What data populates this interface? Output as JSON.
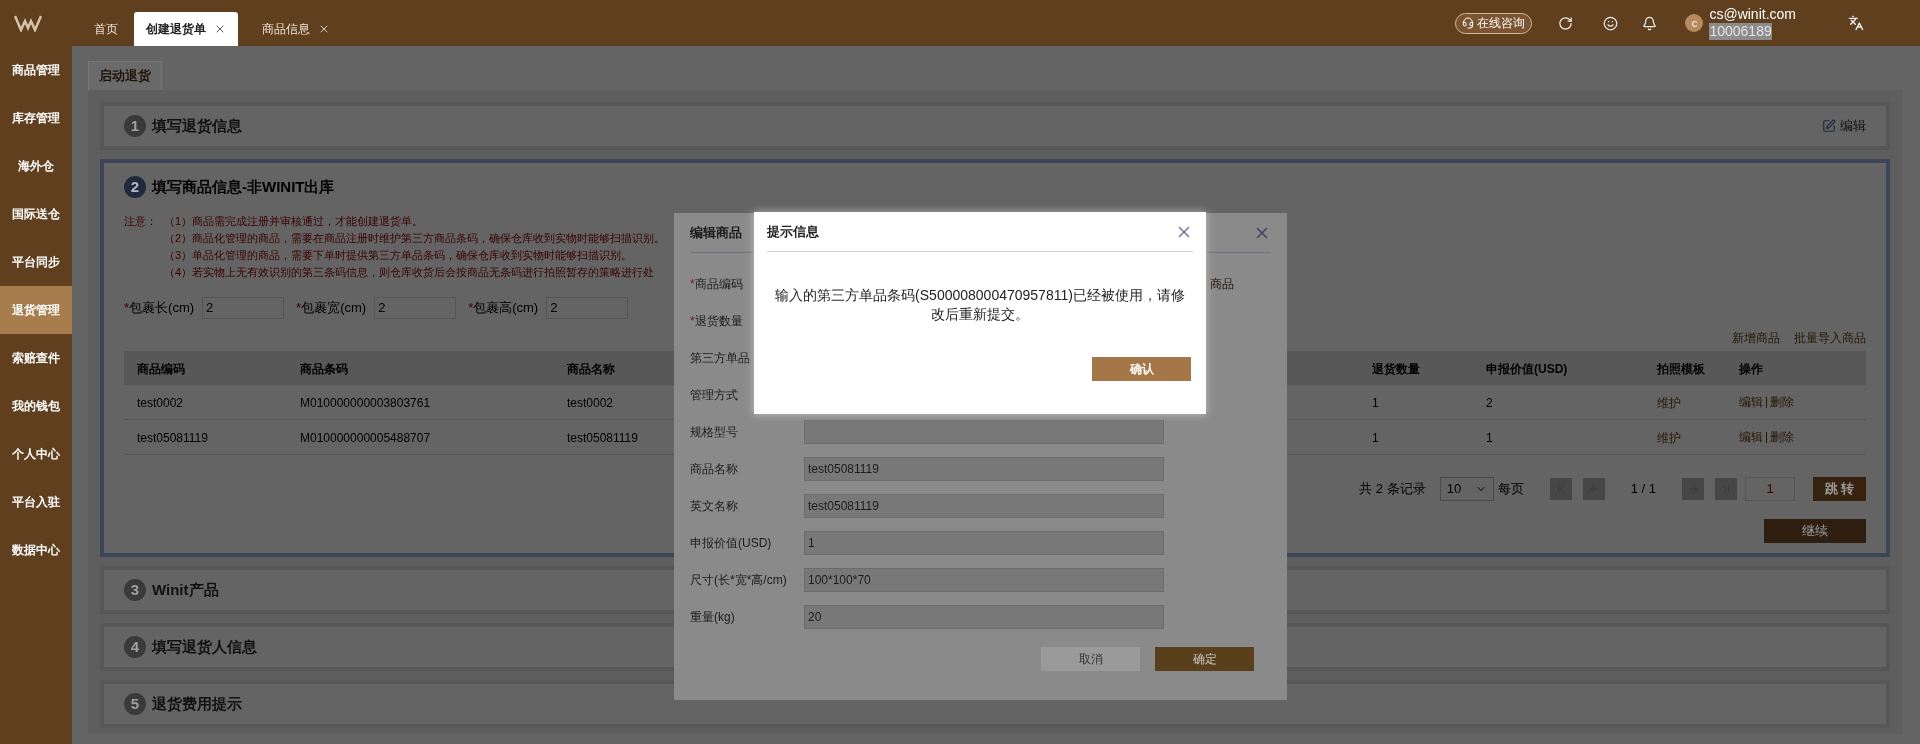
{
  "top_bar": {
    "tabs": [
      {
        "label": "首页",
        "selected": false,
        "closable": false
      },
      {
        "label": "创建退货单",
        "selected": true,
        "closable": true
      },
      {
        "label": "商品信息",
        "selected": false,
        "closable": true
      }
    ],
    "consult_button": "在线咨询",
    "user": {
      "avatar": "c",
      "email": "cs@winit.com",
      "account": "10006189"
    }
  },
  "sidebar": {
    "items": [
      {
        "label": "商品管理",
        "selected": false
      },
      {
        "label": "库存管理",
        "selected": false
      },
      {
        "label": "海外仓",
        "selected": false
      },
      {
        "label": "国际送仓",
        "selected": false
      },
      {
        "label": "平台同步",
        "selected": false
      },
      {
        "label": "退货管理",
        "selected": true
      },
      {
        "label": "索赔查件",
        "selected": false
      },
      {
        "label": "我的钱包",
        "selected": false
      },
      {
        "label": "个人中心",
        "selected": false
      },
      {
        "label": "平台入驻",
        "selected": false
      },
      {
        "label": "数据中心",
        "selected": false
      }
    ]
  },
  "page_tab": "启动退货",
  "sections": [
    {
      "number": "1",
      "title": "填写退货信息",
      "active": false,
      "action": "编辑"
    },
    {
      "number": "2",
      "title": "填写商品信息-非WINIT出库",
      "active": true
    },
    {
      "number": "3",
      "title": "Winit产品",
      "active": false
    },
    {
      "number": "4",
      "title": "填写退货人信息",
      "active": false
    },
    {
      "number": "5",
      "title": "退货费用提示",
      "active": false
    }
  ],
  "product_form": {
    "notes_label": "注意：",
    "notes": [
      "（1）商品需完成注册并审核通过，才能创建退货单。",
      "（2）商品化管理的商品，需要在商品注册时维护第三方商品条码，确保仓库收到实物时能够扫描识别。",
      "（3）单品化管理的商品，需要下单时提供第三方单品条码，确保仓库收到实物时能够扫描识别。",
      "（4）若实物上无有效识别的第三条码信息，则仓库收货后会按商品无条码进行拍照暂存的策略进行处"
    ],
    "package_fields": [
      {
        "mark": "*",
        "label": "包裹长(cm)",
        "value": "2"
      },
      {
        "mark": "*",
        "label": "包裹宽(cm)",
        "value": "2"
      },
      {
        "mark": "*",
        "label": "包裹高(cm)",
        "value": "2"
      }
    ],
    "links": [
      "新增商品",
      "批量导入商品"
    ],
    "table": {
      "columns": [
        "商品编码",
        "商品条码",
        "商品名称",
        "退货数量",
        "申报价值(USD)",
        "拍照模板",
        "操作"
      ],
      "rows": [
        {
          "cells": [
            "test0002",
            "M010000000003803761",
            "test0002",
            "1",
            "2"
          ],
          "template": "维护",
          "actions": [
            "编辑",
            "删除"
          ]
        },
        {
          "cells": [
            "test05081119",
            "M010000000005488707",
            "test05081119",
            "1",
            "1"
          ],
          "template": "维护",
          "actions": [
            "编辑",
            "删除"
          ]
        }
      ]
    },
    "pagination": {
      "summary": "共 2 条记录",
      "page_size": "10",
      "per_page": "每页",
      "page": "1 / 1",
      "jump_value": "1",
      "jump_button": "跳 转"
    },
    "continue_button": "继续"
  },
  "edit_dialog": {
    "title": "编辑商品",
    "fields": [
      {
        "kind": "label",
        "mark": "*",
        "label": "商品编码",
        "side_text": "商品"
      },
      {
        "kind": "label",
        "mark": "*",
        "label": "退货数量"
      },
      {
        "kind": "label",
        "label": "第三方单品"
      },
      {
        "kind": "label",
        "label": "管理方式"
      },
      {
        "kind": "input",
        "label": "规格型号"
      },
      {
        "kind": "input",
        "label": "商品名称",
        "value": "test05081119"
      },
      {
        "kind": "input",
        "label": "英文名称",
        "value": "test05081119"
      },
      {
        "kind": "input",
        "label": "申报价值(USD)",
        "value": "1"
      },
      {
        "kind": "input",
        "label": "尺寸(长*宽*高/cm)",
        "value": "100*100*70"
      },
      {
        "kind": "input",
        "label": "重量(kg)",
        "value": "20"
      }
    ],
    "cancel_button": "取消",
    "confirm_button": "确定"
  },
  "alert_dialog": {
    "title": "提示信息",
    "message": "输入的第三方单品条码(S50000800047095781​1)已经被使用，请修改后重新提交。",
    "button": "确认"
  }
}
